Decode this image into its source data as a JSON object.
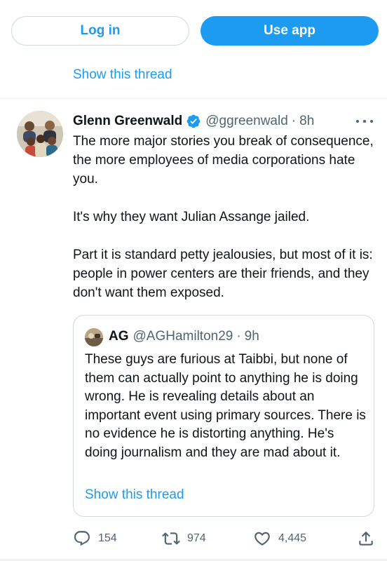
{
  "top_bar": {
    "login_label": "Log in",
    "use_app_label": "Use app"
  },
  "thread_link_top": "Show this thread",
  "tweet": {
    "author_name": "Glenn Greenwald",
    "verified": true,
    "handle": "@ggreenwald",
    "separator": "·",
    "time": "8h",
    "paragraphs": [
      "The more major stories you break of consequence, the more employees of media corporations hate you.",
      "It's why they want Julian Assange jailed.",
      "Part it is standard petty jealousies, but most of it is: people in power centers are their friends, and they don't want them exposed."
    ]
  },
  "quote": {
    "author_name": "AG",
    "handle": "@AGHamilton29",
    "separator": "·",
    "time": "9h",
    "text": "These guys are furious at Taibbi, but none of them can actually point to anything he is doing wrong. He is revealing details about an important event using primary sources. There is no evidence he is distorting anything. He's doing journalism and they are mad about it.",
    "show_thread": "Show this thread"
  },
  "actions": {
    "replies": "154",
    "retweets": "974",
    "likes": "4,445"
  },
  "colors": {
    "accent": "#1d9bf0",
    "text_primary": "#0f1419",
    "text_secondary": "#536471",
    "border": "#cfd9de"
  },
  "icons": {
    "verified": "verified-badge-icon",
    "more": "more-options-icon",
    "reply": "reply-icon",
    "retweet": "retweet-icon",
    "like": "heart-icon",
    "share": "share-icon"
  }
}
